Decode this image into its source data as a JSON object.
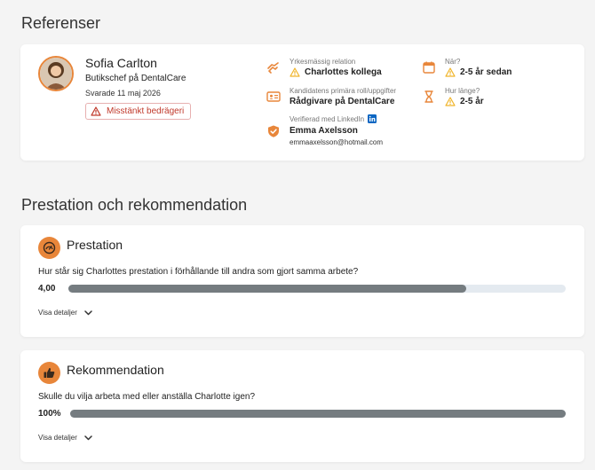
{
  "references": {
    "heading": "Referenser",
    "person": {
      "name": "Sofia Carlton",
      "title": "Butikschef på DentalCare",
      "answered": "Svarade 11 maj 2026",
      "fraud_label": "Misstänkt bedrägeri"
    },
    "relation": {
      "label": "Yrkesmässig relation",
      "value": "Charlottes kollega"
    },
    "role": {
      "label": "Kandidatens primära roll/uppgifter",
      "value": "Rådgivare på DentalCare"
    },
    "linkedin": {
      "label": "Verifierad med LinkedIn",
      "name": "Emma Axelsson",
      "email": "emmaaxelsson@hotmail.com"
    },
    "when": {
      "label": "När?",
      "value": "2-5 år sedan"
    },
    "duration": {
      "label": "Hur länge?",
      "value": "2-5 år"
    }
  },
  "performance_section": {
    "heading": "Prestation och rekommendation",
    "performance": {
      "title": "Prestation",
      "question": "Hur står sig Charlottes prestation i förhållande till andra som gjort samma arbete?",
      "score": "4,00",
      "fraction": 0.8,
      "details_label": "Visa detaljer"
    },
    "recommendation": {
      "title": "Rekommendation",
      "question": "Skulle du vilja arbeta med eller anställa Charlotte igen?",
      "score": "100%",
      "fraction": 1.0,
      "details_label": "Visa detaljer"
    }
  },
  "colors": {
    "accent": "#e8863a",
    "warning": "#f0b429",
    "danger": "#c0392b",
    "linkedin": "#0a66c2",
    "bar_fill": "#757c80",
    "bar_track": "#e4eaf0"
  }
}
